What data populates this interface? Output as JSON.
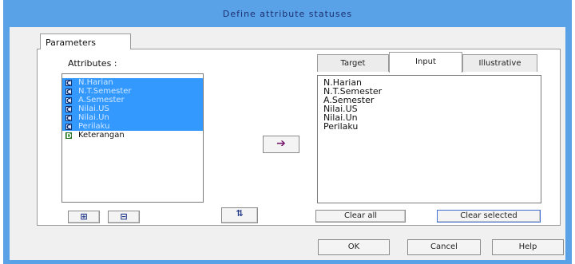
{
  "window": {
    "title": "Define attribute statuses"
  },
  "tabs": {
    "parameters": "Parameters"
  },
  "attributes": {
    "label": "Attributes :",
    "items": [
      {
        "label": "N.Harian",
        "icon": "C"
      },
      {
        "label": "N.T.Semester",
        "icon": "C"
      },
      {
        "label": "A.Semester",
        "icon": "C"
      },
      {
        "label": "Nilai.US",
        "icon": "C"
      },
      {
        "label": "Nilai.Un",
        "icon": "C"
      },
      {
        "label": "Perilaku",
        "icon": "C"
      },
      {
        "label": "Keterangan",
        "icon": "D"
      }
    ]
  },
  "status_tabs": {
    "target": "Target",
    "input": "Input",
    "illustrative": "Illustrative"
  },
  "input_list": [
    "N.Harian",
    "N.T.Semester",
    "A.Semester",
    "Nilai.US",
    "Nilai.Un",
    "Perilaku"
  ],
  "buttons": {
    "clear_all": "Clear all",
    "clear_selected": "Clear selected",
    "ok": "OK",
    "cancel": "Cancel",
    "help": "Help"
  }
}
